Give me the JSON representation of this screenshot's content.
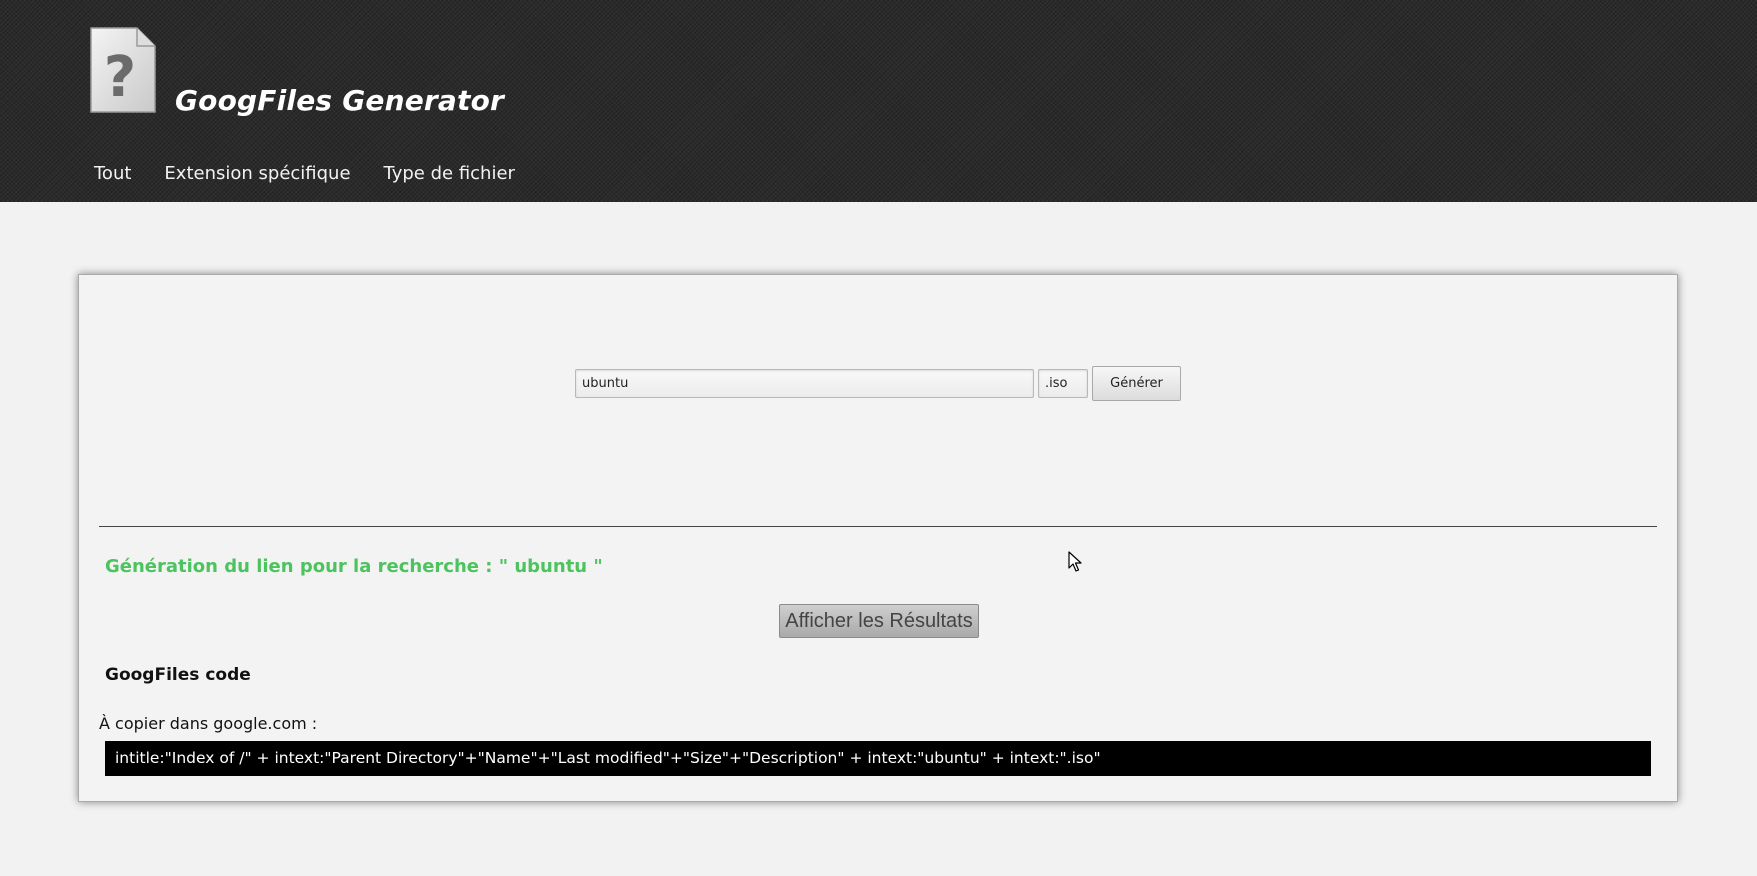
{
  "header": {
    "site_title": "GoogFiles Generator",
    "logo_icon": "file-question-icon"
  },
  "nav": {
    "items": [
      {
        "label": "Tout"
      },
      {
        "label": "Extension spécifique"
      },
      {
        "label": "Type de fichier"
      }
    ]
  },
  "form": {
    "search_value": "ubuntu",
    "extension_value": ".iso",
    "generate_label": "Générer"
  },
  "results": {
    "heading": "Génération du lien pour la recherche : \" ubuntu \"",
    "show_results_label": "Afficher les Résultats",
    "code_heading": "GoogFiles code",
    "copy_label": "À copier dans google.com :",
    "code": "intitle:\"Index of /\" + intext:\"Parent Directory\"+\"Name\"+\"Last modified\"+\"Size\"+\"Description\" + intext:\"ubuntu\" + intext:\".iso\""
  },
  "colors": {
    "header_bg": "#2b2b2b",
    "heading_green": "#4cc35e",
    "code_bg": "#000000"
  }
}
